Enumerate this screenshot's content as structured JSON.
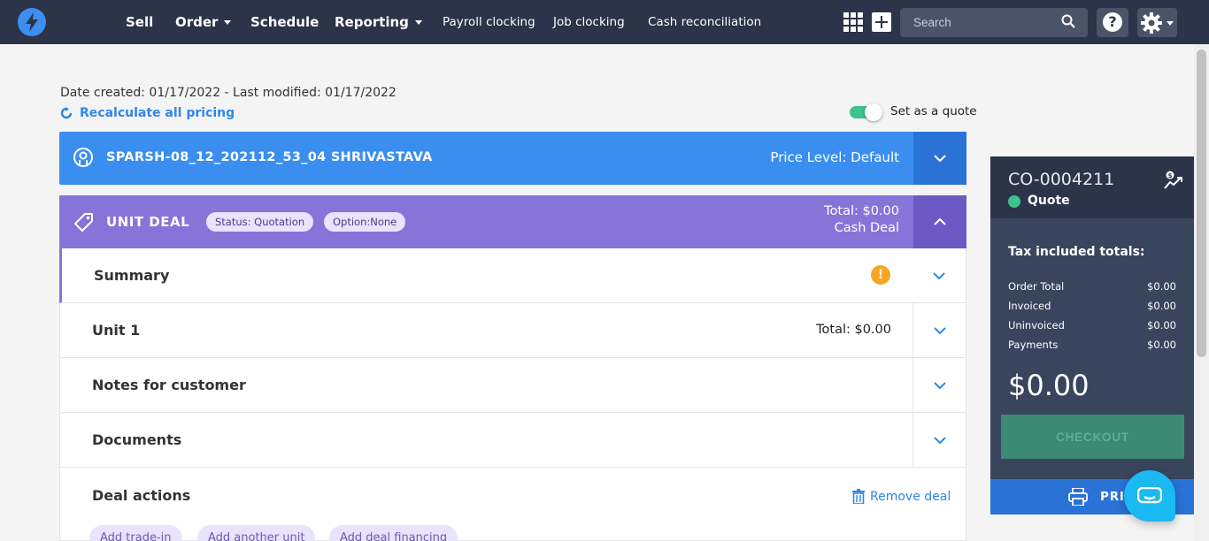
{
  "nav": {
    "main_items": [
      "Sell",
      "Order",
      "Schedule",
      "Reporting"
    ],
    "sub_items": [
      "Payroll clocking",
      "Job clocking",
      "Cash reconciliation"
    ],
    "search_placeholder": "Search",
    "help_label": "?"
  },
  "order": {
    "date_info": "Date created: 01/17/2022 - Last modified: 01/17/2022",
    "recalculate_label": "Recalculate all pricing",
    "quote_toggle_label": "Set as a quote",
    "quote_toggle_on": true
  },
  "customer": {
    "name": "SPARSH-08_12_202112_53_04 SHRIVASTAVA",
    "price_level": "Price Level: Default"
  },
  "deal": {
    "title": "UNIT DEAL",
    "status_pill": "Status: Quotation",
    "option_pill": "Option:None",
    "total": "Total: $0.00",
    "deal_type": "Cash Deal"
  },
  "sections": {
    "summary": "Summary",
    "unit": "Unit 1",
    "unit_total": "Total: $0.00",
    "notes": "Notes for customer",
    "documents": "Documents",
    "deal_actions": "Deal actions",
    "remove_deal": "Remove deal",
    "warning_glyph": "!",
    "action_chips": [
      "Add trade-in",
      "Add another unit",
      "Add deal financing"
    ]
  },
  "panel": {
    "order_number": "CO-0004211",
    "status": "Quote",
    "tax_title": "Tax included totals:",
    "rows": [
      {
        "label": "Order Total",
        "value": "$0.00"
      },
      {
        "label": "Invoiced",
        "value": "$0.00"
      },
      {
        "label": "Uninvoiced",
        "value": "$0.00"
      },
      {
        "label": "Payments",
        "value": "$0.00"
      }
    ],
    "big_total": "$0.00",
    "checkout_label": "CHECKOUT",
    "print_label": "PRINT"
  },
  "colors": {
    "nav_bg": "#2b3448",
    "customer_bar": "#3a8ef0",
    "deal_bar": "#8774d9",
    "status_green": "#3fc28e",
    "warning": "#f5a623"
  }
}
